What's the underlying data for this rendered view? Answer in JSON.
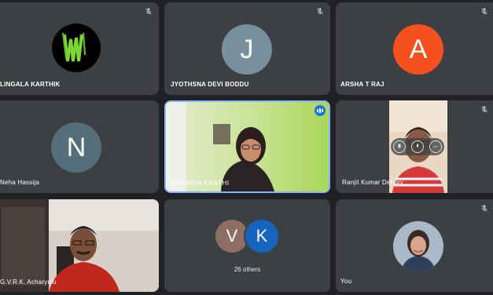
{
  "participants": [
    {
      "name": "LINGALA KARTHIK",
      "avatar_type": "monster-logo",
      "muted": true
    },
    {
      "name": "JYOTHSNA DEVI BODDU",
      "initial": "J",
      "avatar_color": "#78909c",
      "muted": true
    },
    {
      "name": "ARSHA T RAJ",
      "initial": "A",
      "avatar_color": "#f4511e",
      "muted": true
    },
    {
      "name": "Neha Hassija",
      "initial": "N",
      "avatar_color": "#546e7a",
      "muted": false
    },
    {
      "name": "B DONNA KANTHI",
      "video": true,
      "speaking": true
    },
    {
      "name": "Ranjit Kumar Dehury",
      "video": true,
      "muted": true
    },
    {
      "name": "G.V.R.K. Acharyulu",
      "video": true,
      "muted": false
    },
    {
      "others_initials": [
        "V",
        "K"
      ],
      "others_colors": [
        "#8d6e63",
        "#1565c0"
      ],
      "others_label": "26 others"
    },
    {
      "name": "You",
      "avatar_type": "profile-photo",
      "muted": true
    }
  ],
  "colors": {
    "background": "#202124",
    "tile": "#3c4043",
    "speaking_border": "#8ab4f8",
    "speaking_badge": "#1a73e8"
  }
}
